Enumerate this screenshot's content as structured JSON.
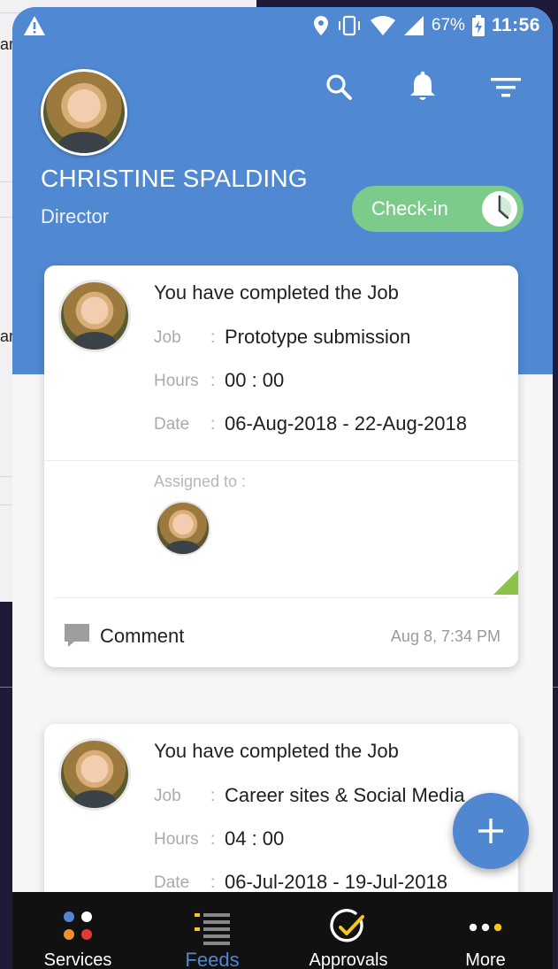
{
  "status_bar": {
    "battery": "67%",
    "time": "11:56"
  },
  "profile": {
    "name": "CHRISTINE SPALDING",
    "role": "Director",
    "checkin_label": "Check-in"
  },
  "feeds": [
    {
      "title": "You have completed the Job",
      "job_label": "Job",
      "job": "Prototype submission",
      "hours_label": "Hours",
      "hours": "00 : 00",
      "date_label": "Date",
      "date": "06-Aug-2018 - 22-Aug-2018",
      "assigned_label": "Assigned to :",
      "comment_label": "Comment",
      "timestamp": "Aug 8, 7:34 PM"
    },
    {
      "title": "You have completed the Job",
      "job_label": "Job",
      "job": "Career sites & Social Media",
      "hours_label": "Hours",
      "hours": "04 : 00",
      "date_label": "Date",
      "date": "06-Jul-2018 - 19-Jul-2018"
    }
  ],
  "bottom_nav": {
    "items": [
      {
        "label": "Services",
        "icon": "services-icon"
      },
      {
        "label": "Feeds",
        "icon": "feeds-icon",
        "active": true
      },
      {
        "label": "Approvals",
        "icon": "approvals-icon"
      },
      {
        "label": "More",
        "icon": "more-icon"
      }
    ]
  },
  "colors": {
    "header": "#5089d2",
    "checkin": "#7ccb8b",
    "accent": "#4f87d1",
    "nav_bg": "#111111",
    "feed_marker": "#8bc34a"
  },
  "background_window": {
    "fragments": [
      "ar",
      "ar"
    ]
  }
}
